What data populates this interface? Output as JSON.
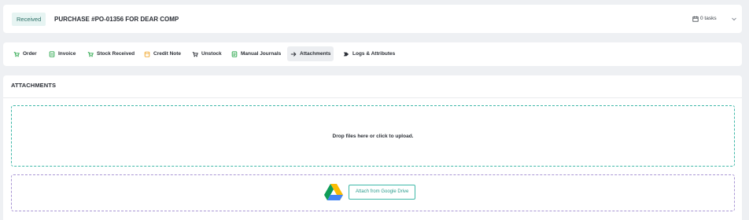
{
  "header": {
    "status": "Received",
    "title": "PURCHASE #PO-01356 FOR DEAR COMP",
    "tasks_label": "0 tasks"
  },
  "tabs": [
    {
      "label": "Order",
      "icon": "cart-icon",
      "color": "#2fa84f"
    },
    {
      "label": "Invoice",
      "icon": "invoice-icon",
      "color": "#2fa84f"
    },
    {
      "label": "Stock Received",
      "icon": "cart-icon",
      "color": "#2fa84f"
    },
    {
      "label": "Credit Note",
      "icon": "credit-note-icon",
      "color": "#f0a830"
    },
    {
      "label": "Unstock",
      "icon": "cart-icon",
      "color": "#2b2f36"
    },
    {
      "label": "Manual Journals",
      "icon": "journal-icon",
      "color": "#2fa84f"
    },
    {
      "label": "Attachments",
      "icon": "arrow-right-icon",
      "color": "#2b2f36",
      "active": true
    },
    {
      "label": "Logs & Attributes",
      "icon": "tag-icon",
      "color": "#2b2f36"
    }
  ],
  "attachments": {
    "title": "ATTACHMENTS",
    "dropzone_text": "Drop files here or click to upload.",
    "gdrive_button": "Attach from Google Drive"
  },
  "colors": {
    "accent": "#3fb8a8",
    "success": "#2fa84f",
    "warning": "#f0a830",
    "gdrive_border": "#a996d4"
  }
}
